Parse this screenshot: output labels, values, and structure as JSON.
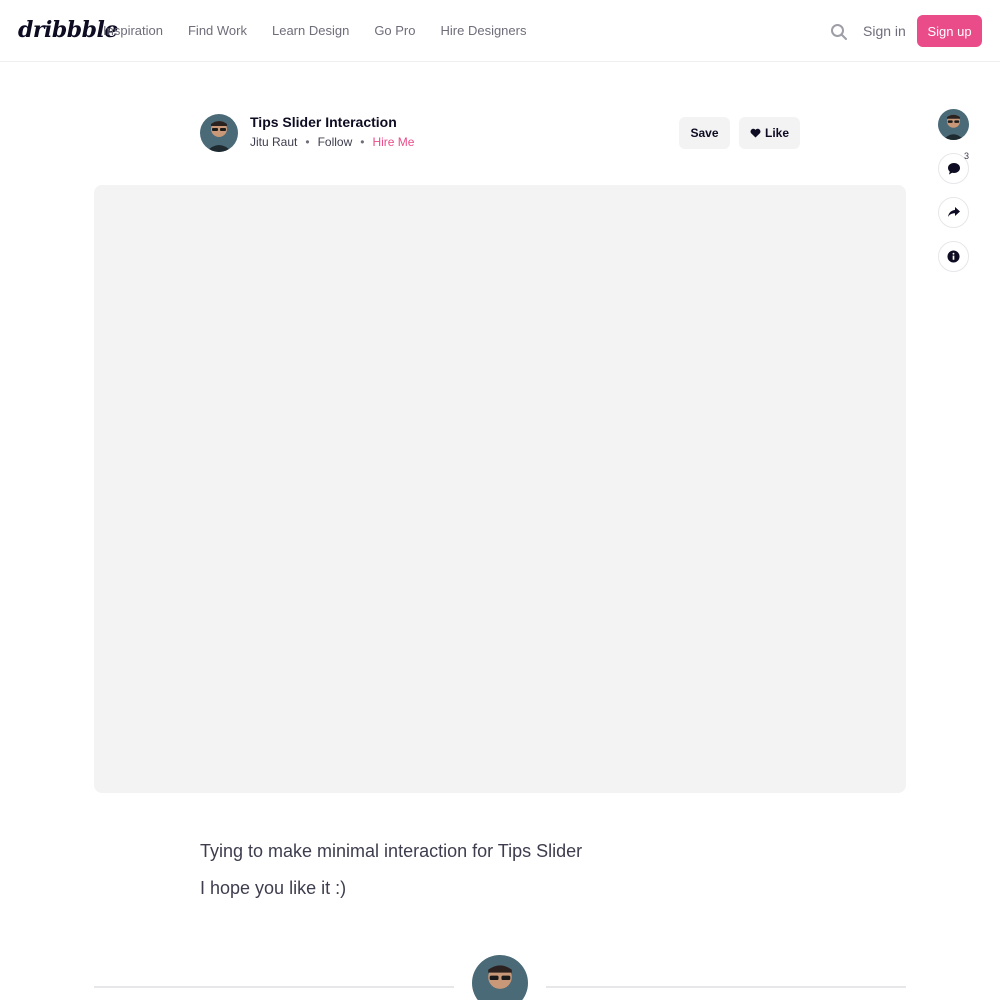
{
  "header": {
    "logo": "dribbble",
    "nav": [
      "Inspiration",
      "Find Work",
      "Learn Design",
      "Go Pro",
      "Hire Designers"
    ],
    "signin": "Sign in",
    "signup": "Sign up",
    "search_icon": "search-icon"
  },
  "shot": {
    "title": "Tips Slider Interaction",
    "author": "Jitu Raut",
    "follow": "Follow",
    "hire": "Hire Me",
    "save": "Save",
    "like": "Like"
  },
  "rail": {
    "comment_count": "3",
    "icons": [
      "comment-icon",
      "share-icon",
      "info-icon"
    ]
  },
  "description": [
    "Tying to make minimal interaction for Tips Slider",
    "I hope you like it :)"
  ],
  "colors": {
    "brand_pink": "#ea4c89",
    "media_bg": "#f3f3f4",
    "text_dark": "#0d0c22",
    "text_muted": "#6e6d7a"
  }
}
